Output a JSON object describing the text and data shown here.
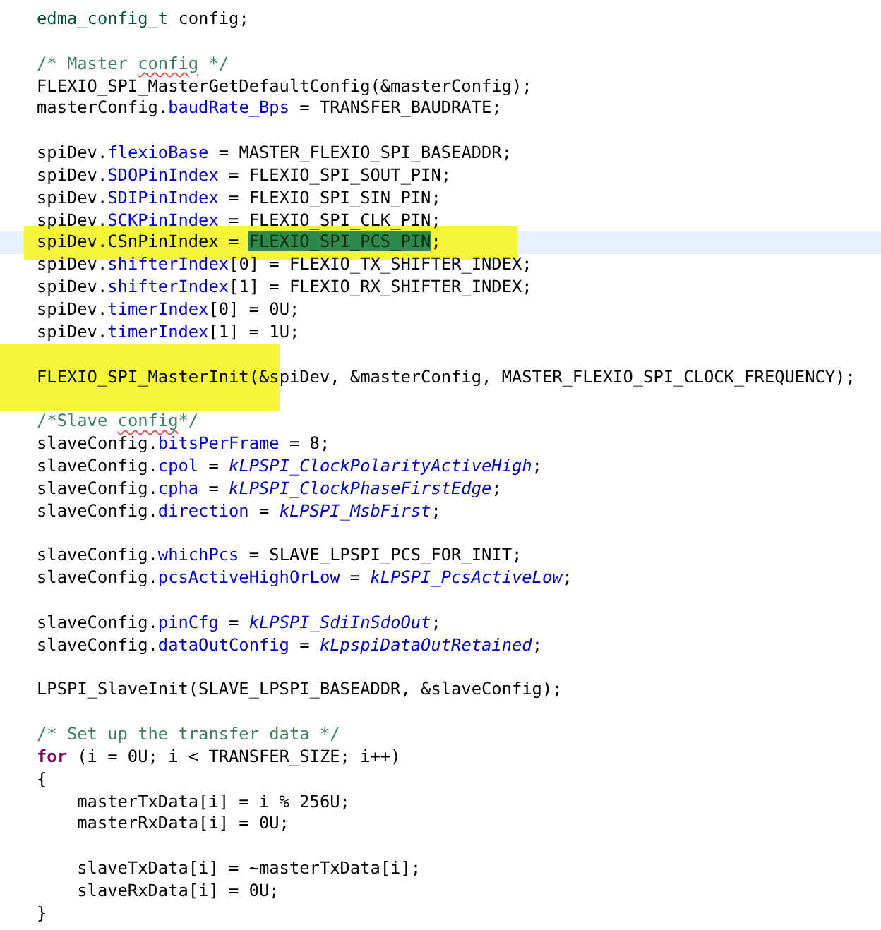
{
  "editor": {
    "lines": [
      {
        "kind": "code",
        "tokens": [
          {
            "kind": "type",
            "text": "edma_config_t"
          },
          {
            "kind": "plain",
            "text": " config;"
          }
        ]
      },
      {
        "kind": "blank"
      },
      {
        "kind": "code",
        "tokens": [
          {
            "kind": "comment",
            "text": "/* Master "
          },
          {
            "kind": "comment",
            "text": "config",
            "spell_error": true
          },
          {
            "kind": "comment",
            "text": " */"
          }
        ]
      },
      {
        "kind": "code",
        "tokens": [
          {
            "kind": "plain",
            "text": "FLEXIO_SPI_MasterGetDefaultConfig(&masterConfig);"
          }
        ]
      },
      {
        "kind": "code",
        "tokens": [
          {
            "kind": "plain",
            "text": "masterConfig."
          },
          {
            "kind": "field",
            "text": "baudRate_Bps"
          },
          {
            "kind": "plain",
            "text": " = TRANSFER_BAUDRATE;"
          }
        ]
      },
      {
        "kind": "blank"
      },
      {
        "kind": "code",
        "tokens": [
          {
            "kind": "plain",
            "text": "spiDev."
          },
          {
            "kind": "field",
            "text": "flexioBase"
          },
          {
            "kind": "plain",
            "text": " = MASTER_FLEXIO_SPI_BASEADDR;"
          }
        ]
      },
      {
        "kind": "code",
        "tokens": [
          {
            "kind": "plain",
            "text": "spiDev."
          },
          {
            "kind": "field",
            "text": "SDOPinIndex"
          },
          {
            "kind": "plain",
            "text": " = FLEXIO_SPI_SOUT_PIN;"
          }
        ]
      },
      {
        "kind": "code",
        "tokens": [
          {
            "kind": "plain",
            "text": "spiDev."
          },
          {
            "kind": "field",
            "text": "SDIPinIndex"
          },
          {
            "kind": "plain",
            "text": " = FLEXIO_SPI_SIN_PIN;"
          }
        ]
      },
      {
        "kind": "code",
        "tokens": [
          {
            "kind": "plain",
            "text": "spiDev."
          },
          {
            "kind": "field",
            "text": "SCKPinIndex"
          },
          {
            "kind": "plain",
            "text": " = FLEXIO_SPI_CLK_PIN;"
          }
        ]
      },
      {
        "kind": "code",
        "current": true,
        "tokens": [
          {
            "kind": "plain",
            "text": "spiDev.CSnPinIndex = ",
            "marked": true
          },
          {
            "kind": "plain",
            "text": "FLEXIO_SPI_PCS_PIN",
            "selected": true,
            "marked": true
          },
          {
            "kind": "plain",
            "text": ";",
            "marked": true
          }
        ]
      },
      {
        "kind": "code",
        "tokens": [
          {
            "kind": "plain",
            "text": "spiDev."
          },
          {
            "kind": "field",
            "text": "shifterIndex"
          },
          {
            "kind": "plain",
            "text": "[0] = FLEXIO_TX_SHIFTER_INDEX;"
          }
        ]
      },
      {
        "kind": "code",
        "tokens": [
          {
            "kind": "plain",
            "text": "spiDev."
          },
          {
            "kind": "field",
            "text": "shifterIndex"
          },
          {
            "kind": "plain",
            "text": "[1] = FLEXIO_RX_SHIFTER_INDEX;"
          }
        ]
      },
      {
        "kind": "code",
        "tokens": [
          {
            "kind": "plain",
            "text": "spiDev."
          },
          {
            "kind": "field",
            "text": "timerIndex"
          },
          {
            "kind": "plain",
            "text": "[0] = 0U;"
          }
        ]
      },
      {
        "kind": "code",
        "tokens": [
          {
            "kind": "plain",
            "text": "spiDev."
          },
          {
            "kind": "field",
            "text": "timerIndex"
          },
          {
            "kind": "plain",
            "text": "[1] = 1U;"
          }
        ]
      },
      {
        "kind": "blank"
      },
      {
        "kind": "code",
        "tokens": [
          {
            "kind": "plain",
            "text": "FLEXIO_SPI_MasterInit",
            "marked": true
          },
          {
            "kind": "plain",
            "text": "(&spiDev, &masterConfig, MASTER_FLEXIO_SPI_CLOCK_FREQUENCY);"
          }
        ]
      },
      {
        "kind": "blank"
      },
      {
        "kind": "code",
        "tokens": [
          {
            "kind": "comment",
            "text": "/*Slave "
          },
          {
            "kind": "comment",
            "text": "config",
            "spell_error": true
          },
          {
            "kind": "comment",
            "text": "*/"
          }
        ]
      },
      {
        "kind": "code",
        "tokens": [
          {
            "kind": "plain",
            "text": "slaveConfig."
          },
          {
            "kind": "field",
            "text": "bitsPerFrame"
          },
          {
            "kind": "plain",
            "text": " = 8;"
          }
        ]
      },
      {
        "kind": "code",
        "tokens": [
          {
            "kind": "plain",
            "text": "slaveConfig."
          },
          {
            "kind": "field",
            "text": "cpol"
          },
          {
            "kind": "plain",
            "text": " = "
          },
          {
            "kind": "constant",
            "text": "kLPSPI_ClockPolarityActiveHigh"
          },
          {
            "kind": "plain",
            "text": ";"
          }
        ]
      },
      {
        "kind": "code",
        "tokens": [
          {
            "kind": "plain",
            "text": "slaveConfig."
          },
          {
            "kind": "field",
            "text": "cpha"
          },
          {
            "kind": "plain",
            "text": " = "
          },
          {
            "kind": "constant",
            "text": "kLPSPI_ClockPhaseFirstEdge"
          },
          {
            "kind": "plain",
            "text": ";"
          }
        ]
      },
      {
        "kind": "code",
        "tokens": [
          {
            "kind": "plain",
            "text": "slaveConfig."
          },
          {
            "kind": "field",
            "text": "direction"
          },
          {
            "kind": "plain",
            "text": " = "
          },
          {
            "kind": "constant",
            "text": "kLPSPI_MsbFirst"
          },
          {
            "kind": "plain",
            "text": ";"
          }
        ]
      },
      {
        "kind": "blank"
      },
      {
        "kind": "code",
        "tokens": [
          {
            "kind": "plain",
            "text": "slaveConfig."
          },
          {
            "kind": "field",
            "text": "whichPcs"
          },
          {
            "kind": "plain",
            "text": " = SLAVE_LPSPI_PCS_FOR_INIT;"
          }
        ]
      },
      {
        "kind": "code",
        "tokens": [
          {
            "kind": "plain",
            "text": "slaveConfig."
          },
          {
            "kind": "field",
            "text": "pcsActiveHighOrLow"
          },
          {
            "kind": "plain",
            "text": " = "
          },
          {
            "kind": "constant",
            "text": "kLPSPI_PcsActiveLow"
          },
          {
            "kind": "plain",
            "text": ";"
          }
        ]
      },
      {
        "kind": "blank"
      },
      {
        "kind": "code",
        "tokens": [
          {
            "kind": "plain",
            "text": "slaveConfig."
          },
          {
            "kind": "field",
            "text": "pinCfg"
          },
          {
            "kind": "plain",
            "text": " = "
          },
          {
            "kind": "constant",
            "text": "kLPSPI_SdiInSdoOut"
          },
          {
            "kind": "plain",
            "text": ";"
          }
        ]
      },
      {
        "kind": "code",
        "tokens": [
          {
            "kind": "plain",
            "text": "slaveConfig."
          },
          {
            "kind": "field",
            "text": "dataOutConfig"
          },
          {
            "kind": "plain",
            "text": " = "
          },
          {
            "kind": "constant",
            "text": "kLpspiDataOutRetained"
          },
          {
            "kind": "plain",
            "text": ";"
          }
        ]
      },
      {
        "kind": "blank"
      },
      {
        "kind": "code",
        "tokens": [
          {
            "kind": "plain",
            "text": "LPSPI_SlaveInit(SLAVE_LPSPI_BASEADDR, &slaveConfig);"
          }
        ]
      },
      {
        "kind": "blank"
      },
      {
        "kind": "code",
        "tokens": [
          {
            "kind": "comment",
            "text": "/* Set up the transfer data */"
          }
        ]
      },
      {
        "kind": "code",
        "tokens": [
          {
            "kind": "keyword",
            "text": "for"
          },
          {
            "kind": "plain",
            "text": " (i = 0U; i < TRANSFER_SIZE; i++)"
          }
        ]
      },
      {
        "kind": "code",
        "tokens": [
          {
            "kind": "plain",
            "text": "{"
          }
        ]
      },
      {
        "kind": "code",
        "tokens": [
          {
            "kind": "plain",
            "text": "    masterTxData[i] = i % 256U;"
          }
        ]
      },
      {
        "kind": "code",
        "tokens": [
          {
            "kind": "plain",
            "text": "    masterRxData[i] = 0U;"
          }
        ]
      },
      {
        "kind": "blank"
      },
      {
        "kind": "code",
        "tokens": [
          {
            "kind": "plain",
            "text": "    slaveTxData[i] = ~masterTxData[i];"
          }
        ]
      },
      {
        "kind": "code",
        "tokens": [
          {
            "kind": "plain",
            "text": "    slaveRxData[i] = 0U;"
          }
        ]
      },
      {
        "kind": "code",
        "tokens": [
          {
            "kind": "plain",
            "text": "}"
          }
        ]
      }
    ]
  }
}
